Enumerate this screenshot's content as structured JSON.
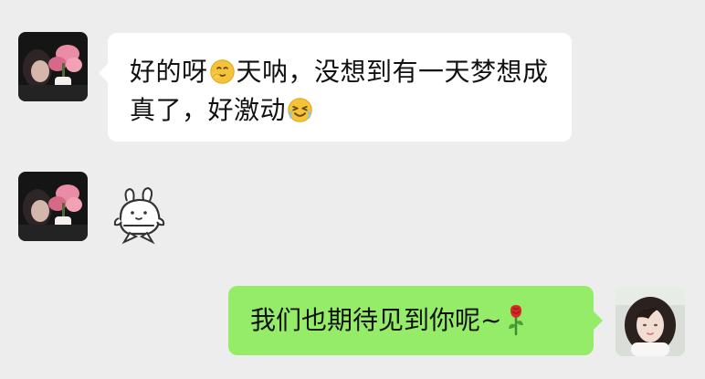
{
  "messages": [
    {
      "side": "left",
      "type": "text",
      "parts": {
        "before_emoji_1": "好的呀",
        "emoji_1_name": "smirk-hand-emoji",
        "middle_text": "天呐，没想到有一天梦想成真了，好激动",
        "emoji_2_name": "laugh-cry-emoji"
      }
    },
    {
      "side": "left",
      "type": "sticker",
      "sticker_name": "bunny-sticker"
    },
    {
      "side": "right",
      "type": "text",
      "text": "我们也期待见到你呢~",
      "emoji_name": "rose-emoji"
    }
  ],
  "avatars": {
    "other_user": "woman-with-flowers-avatar",
    "self_user": "self-avatar"
  },
  "colors": {
    "background": "#ededed",
    "incoming_bubble": "#ffffff",
    "outgoing_bubble": "#95ec69",
    "text": "#111111"
  }
}
